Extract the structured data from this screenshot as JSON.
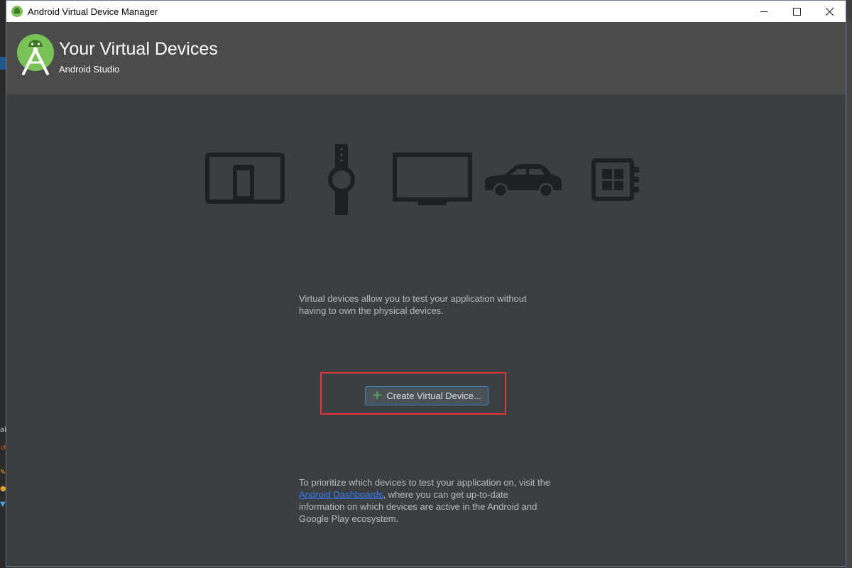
{
  "window": {
    "title": "Android Virtual Device Manager"
  },
  "header": {
    "heading": "Your Virtual Devices",
    "subheading": "Android Studio"
  },
  "device_icons": [
    "tablet-phone-icon",
    "watch-icon",
    "tv-icon",
    "car-icon",
    "things-board-icon"
  ],
  "intro": {
    "text": "Virtual devices allow you to test your application without having to own the physical devices."
  },
  "create_button": {
    "label": "Create Virtual Device..."
  },
  "footer": {
    "before_link": "To prioritize which devices to test your application on, visit the ",
    "link_text": "Android Dashboards",
    "after_link": ", where you can get up-to-date information on which devices are active in the Android and Google Play ecosystem."
  },
  "colors": {
    "background": "#3c3f41",
    "header": "#4b4b4b",
    "icon": "#1f2022",
    "link": "#3b7cf5",
    "highlight": "#e8353a",
    "plus": "#59a85a"
  }
}
